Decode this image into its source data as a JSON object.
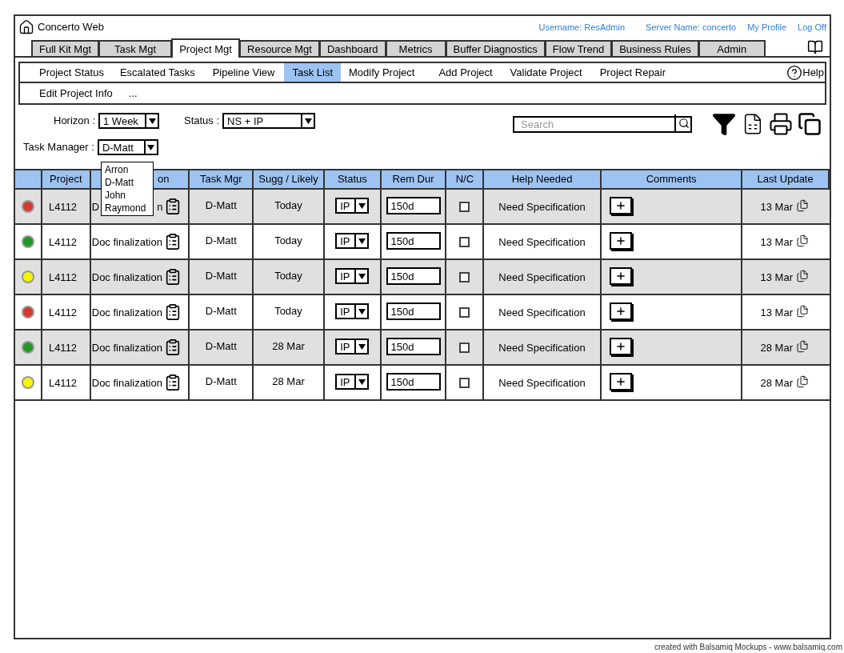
{
  "app": {
    "title": "Concerto Web"
  },
  "header_links": [
    {
      "label": "Username: ResAdmin"
    },
    {
      "label": "Server Name: concerto"
    },
    {
      "label": "My Profile"
    },
    {
      "label": "Log Off"
    }
  ],
  "tabs": [
    {
      "label": "Full Kit Mgt",
      "selected": false
    },
    {
      "label": "Task Mgt",
      "selected": false
    },
    {
      "label": "Project Mgt",
      "selected": true
    },
    {
      "label": "Resource Mgt",
      "selected": false
    },
    {
      "label": "Dashboard",
      "selected": false
    },
    {
      "label": "Metrics",
      "selected": false
    },
    {
      "label": "Buffer Diagnostics",
      "selected": false
    },
    {
      "label": "Flow Trend",
      "selected": false
    },
    {
      "label": "Business Rules",
      "selected": false
    },
    {
      "label": "Admin",
      "selected": false
    }
  ],
  "subnav": {
    "rows": [
      [
        {
          "label": "Project Status",
          "selected": false
        },
        {
          "label": "Escalated Tasks",
          "selected": false
        },
        {
          "label": "Pipeline View",
          "selected": false
        },
        {
          "label": "Task List",
          "selected": true
        },
        {
          "label": "Modify Project",
          "selected": false
        },
        {
          "label": "Add Project",
          "selected": false
        },
        {
          "label": "Validate Project",
          "selected": false
        },
        {
          "label": "Project Repair",
          "selected": false
        }
      ],
      [
        {
          "label": "Edit Project Info",
          "selected": false
        },
        {
          "label": "...",
          "selected": false
        }
      ]
    ],
    "help": "Help"
  },
  "filters": {
    "horizon": {
      "label": "Horizon :",
      "value": "1 Week"
    },
    "status": {
      "label": "Status :",
      "value": "NS + IP"
    },
    "task_manager": {
      "label": "Task Manager :",
      "value": "D-Matt",
      "expanded": true,
      "options": [
        "Arron",
        "D-Matt",
        "John",
        "Raymond"
      ]
    },
    "search": {
      "placeholder": "Search"
    }
  },
  "table": {
    "columns": [
      "Project",
      "on",
      "Task Mgr",
      "Sugg / Likely",
      "Status",
      "Rem Dur",
      "N/C",
      "Help Needed",
      "Comments",
      "Last Update"
    ],
    "rows": [
      {
        "color": "#d63a2f",
        "project": "L4112",
        "task": "D",
        "task_end": "n",
        "task_mgr": "D-Matt",
        "sugg": "Today",
        "status": "IP",
        "rem_dur": "150d",
        "nc": false,
        "help": "Need Specification",
        "last_update": "13 Mar"
      },
      {
        "color": "#1e9a23",
        "project": "L4112",
        "task": "Doc finalization",
        "task_mgr": "D-Matt",
        "sugg": "Today",
        "status": "IP",
        "rem_dur": "150d",
        "nc": false,
        "help": "Need Specification",
        "last_update": "13 Mar"
      },
      {
        "color": "#f5f500",
        "project": "L4112",
        "task": "Doc finalization",
        "task_mgr": "D-Matt",
        "sugg": "Today",
        "status": "IP",
        "rem_dur": "150d",
        "nc": false,
        "help": "Need Specification",
        "last_update": "13 Mar"
      },
      {
        "color": "#d63a2f",
        "project": "L4112",
        "task": "Doc finalization",
        "task_mgr": "D-Matt",
        "sugg": "Today",
        "status": "IP",
        "rem_dur": "150d",
        "nc": false,
        "help": "Need Specification",
        "last_update": "13 Mar"
      },
      {
        "color": "#1e9a23",
        "project": "L4112",
        "task": "Doc finalization",
        "task_mgr": "D-Matt",
        "sugg": "28 Mar",
        "status": "IP",
        "rem_dur": "150d",
        "nc": false,
        "help": "Need Specification",
        "last_update": "28 Mar"
      },
      {
        "color": "#f5f500",
        "project": "L4112",
        "task": "Doc finalization",
        "task_mgr": "D-Matt",
        "sugg": "28 Mar",
        "status": "IP",
        "rem_dur": "150d",
        "nc": false,
        "help": "Need Specification",
        "last_update": "28 Mar"
      }
    ]
  },
  "footer": "created with Balsamiq Mockups - www.balsamiq.com"
}
